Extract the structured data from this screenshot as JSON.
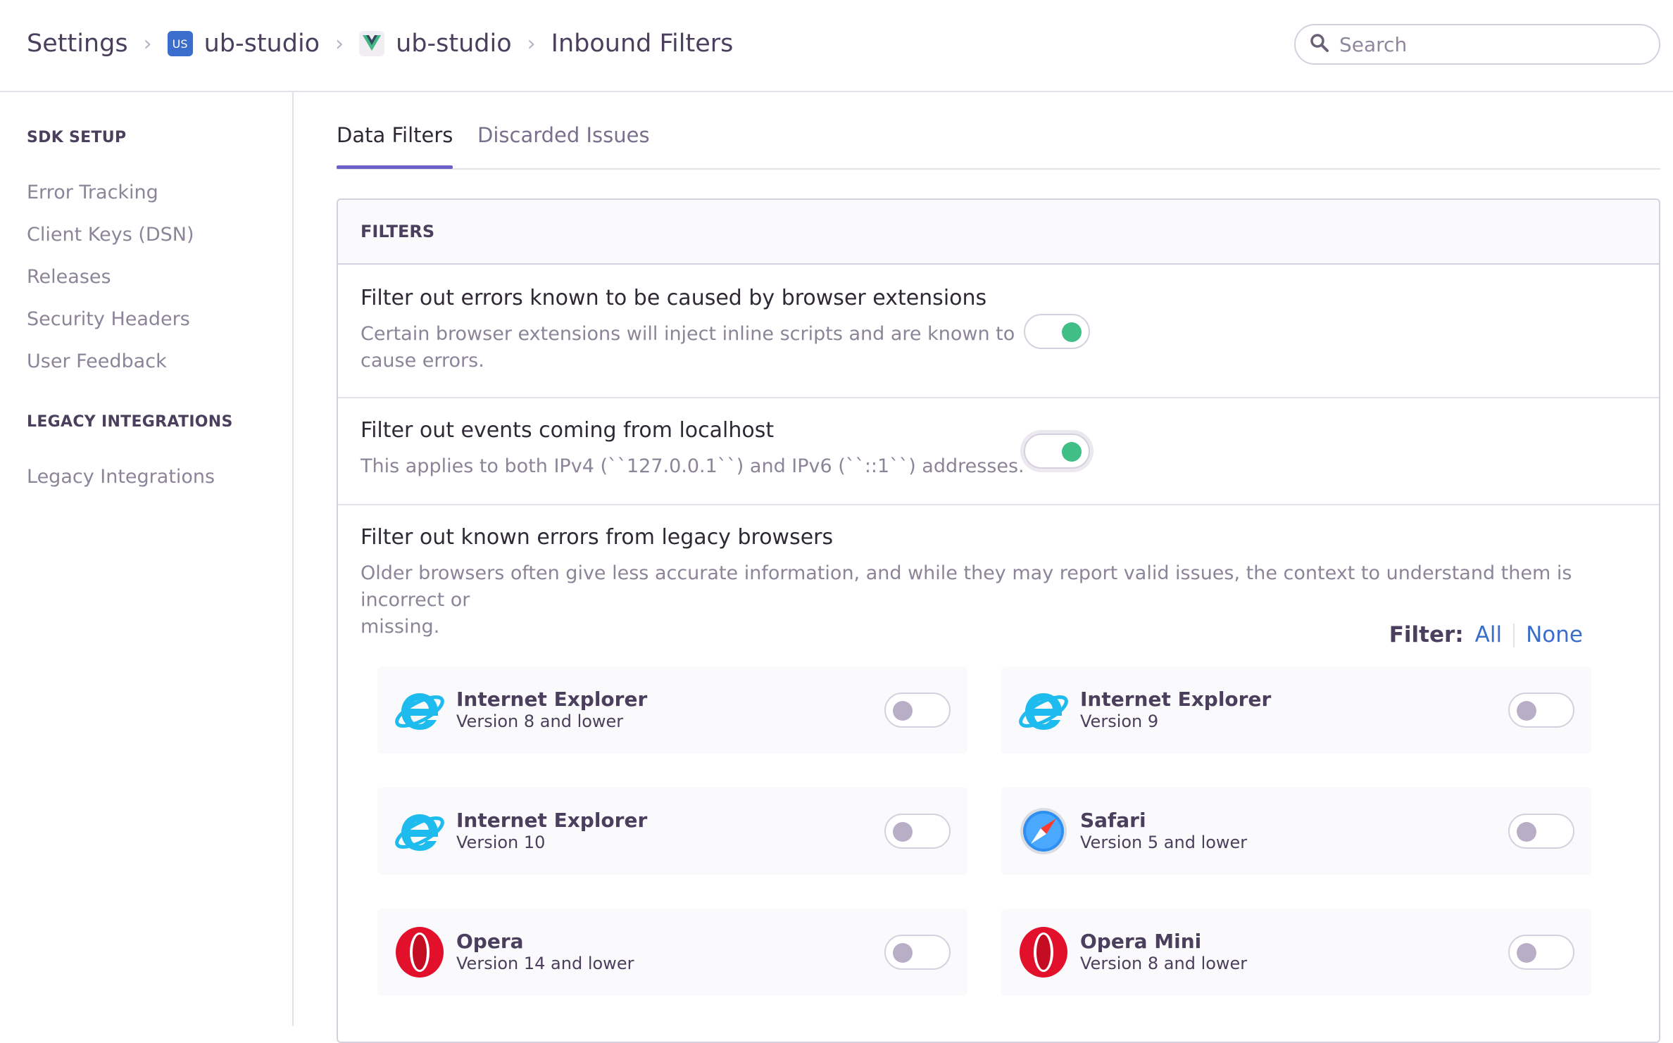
{
  "breadcrumb": {
    "settings": "Settings",
    "org_badge": "US",
    "org": "ub-studio",
    "project": "ub-studio",
    "page": "Inbound Filters"
  },
  "search": {
    "placeholder": "Search"
  },
  "sidebar": {
    "sections": [
      {
        "heading": "SDK SETUP",
        "items": [
          "Error Tracking",
          "Client Keys (DSN)",
          "Releases",
          "Security Headers",
          "User Feedback"
        ]
      },
      {
        "heading": "LEGACY INTEGRATIONS",
        "items": [
          "Legacy Integrations"
        ]
      }
    ]
  },
  "tabs": [
    {
      "label": "Data Filters",
      "active": true
    },
    {
      "label": "Discarded Issues",
      "active": false
    }
  ],
  "panel": {
    "heading": "FILTERS",
    "filters": [
      {
        "title": "Filter out errors known to be caused by browser extensions",
        "desc_line1": "Certain browser extensions will inject inline scripts and are known to",
        "desc_line2": "cause errors.",
        "enabled": true
      },
      {
        "title": "Filter out events coming from localhost",
        "desc_line1": "This applies to both IPv4 (``127.0.0.1``) and IPv6 (``::1``) addresses.",
        "enabled": true
      },
      {
        "title": "Filter out known errors from legacy browsers",
        "desc_line1": "Older browsers often give less accurate information, and while they may report valid issues, the context to understand them is incorrect or",
        "desc_line2": "missing."
      }
    ],
    "filter_label": "Filter:",
    "filter_all": "All",
    "filter_none": "None",
    "browsers": [
      {
        "name": "Internet Explorer",
        "version": "Version 8 and lower",
        "icon": "internet-explorer-icon",
        "enabled": false
      },
      {
        "name": "Internet Explorer",
        "version": "Version 9",
        "icon": "internet-explorer-icon",
        "enabled": false
      },
      {
        "name": "Internet Explorer",
        "version": "Version 10",
        "icon": "internet-explorer-icon",
        "enabled": false
      },
      {
        "name": "Safari",
        "version": "Version 5 and lower",
        "icon": "safari-icon",
        "enabled": false
      },
      {
        "name": "Opera",
        "version": "Version 14 and lower",
        "icon": "opera-icon",
        "enabled": false
      },
      {
        "name": "Opera Mini",
        "version": "Version 8 and lower",
        "icon": "opera-icon",
        "enabled": false
      }
    ]
  },
  "colors": {
    "accent": "#6c5fc7",
    "toggle_on": "#3fbf86",
    "link": "#3b6ecc"
  }
}
